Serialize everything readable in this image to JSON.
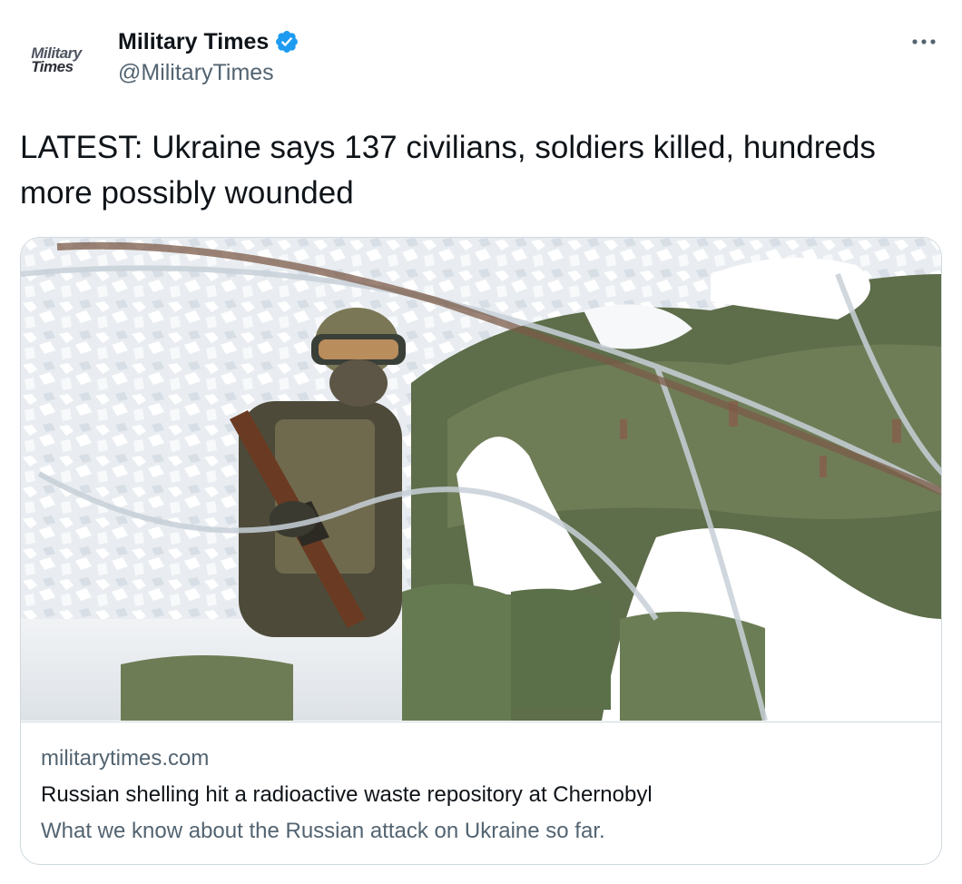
{
  "author": {
    "avatar_logo_line1": "Military",
    "avatar_logo_line2": "Times",
    "display_name": "Military Times",
    "handle": "@MilitaryTimes",
    "verified": true
  },
  "tweet": {
    "text": "LATEST: Ukraine says 137 civilians, soldiers killed, hundreds more possibly wounded"
  },
  "link_card": {
    "domain": "militarytimes.com",
    "title": "Russian shelling hit a radioactive waste repository at Chernobyl",
    "description": "What we know about the Russian attack on Ukraine so far."
  },
  "colors": {
    "text_primary": "#0f1419",
    "text_secondary": "#536471",
    "verified_badge": "#1d9bf0",
    "border": "#cfd9de"
  },
  "icons": {
    "more": "more-horizontal-icon",
    "verified": "verified-badge-icon"
  }
}
